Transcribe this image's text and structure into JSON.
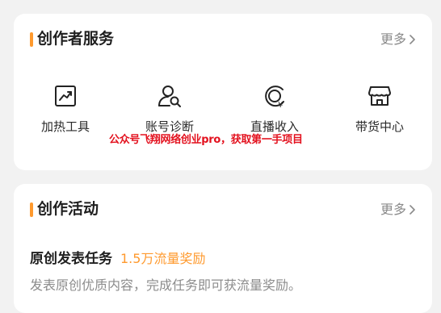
{
  "service": {
    "title": "创作者服务",
    "more": "更多",
    "tools": [
      {
        "label": "加热工具",
        "icon": "trend-chart-icon"
      },
      {
        "label": "账号诊断",
        "icon": "user-search-icon"
      },
      {
        "label": "直播收入",
        "icon": "yen-coin-icon"
      },
      {
        "label": "带货中心",
        "icon": "shop-icon"
      }
    ]
  },
  "watermark": "公众号飞翔网络创业pro，获取第一手项目",
  "activity": {
    "title": "创作活动",
    "more": "更多",
    "task": {
      "title": "原创发表任务",
      "reward": "1.5万流量奖励",
      "desc": "发表原创优质内容，完成任务即可获流量奖励。"
    }
  },
  "colors": {
    "accent": "#ff9a2e",
    "watermark": "#e3111e"
  }
}
